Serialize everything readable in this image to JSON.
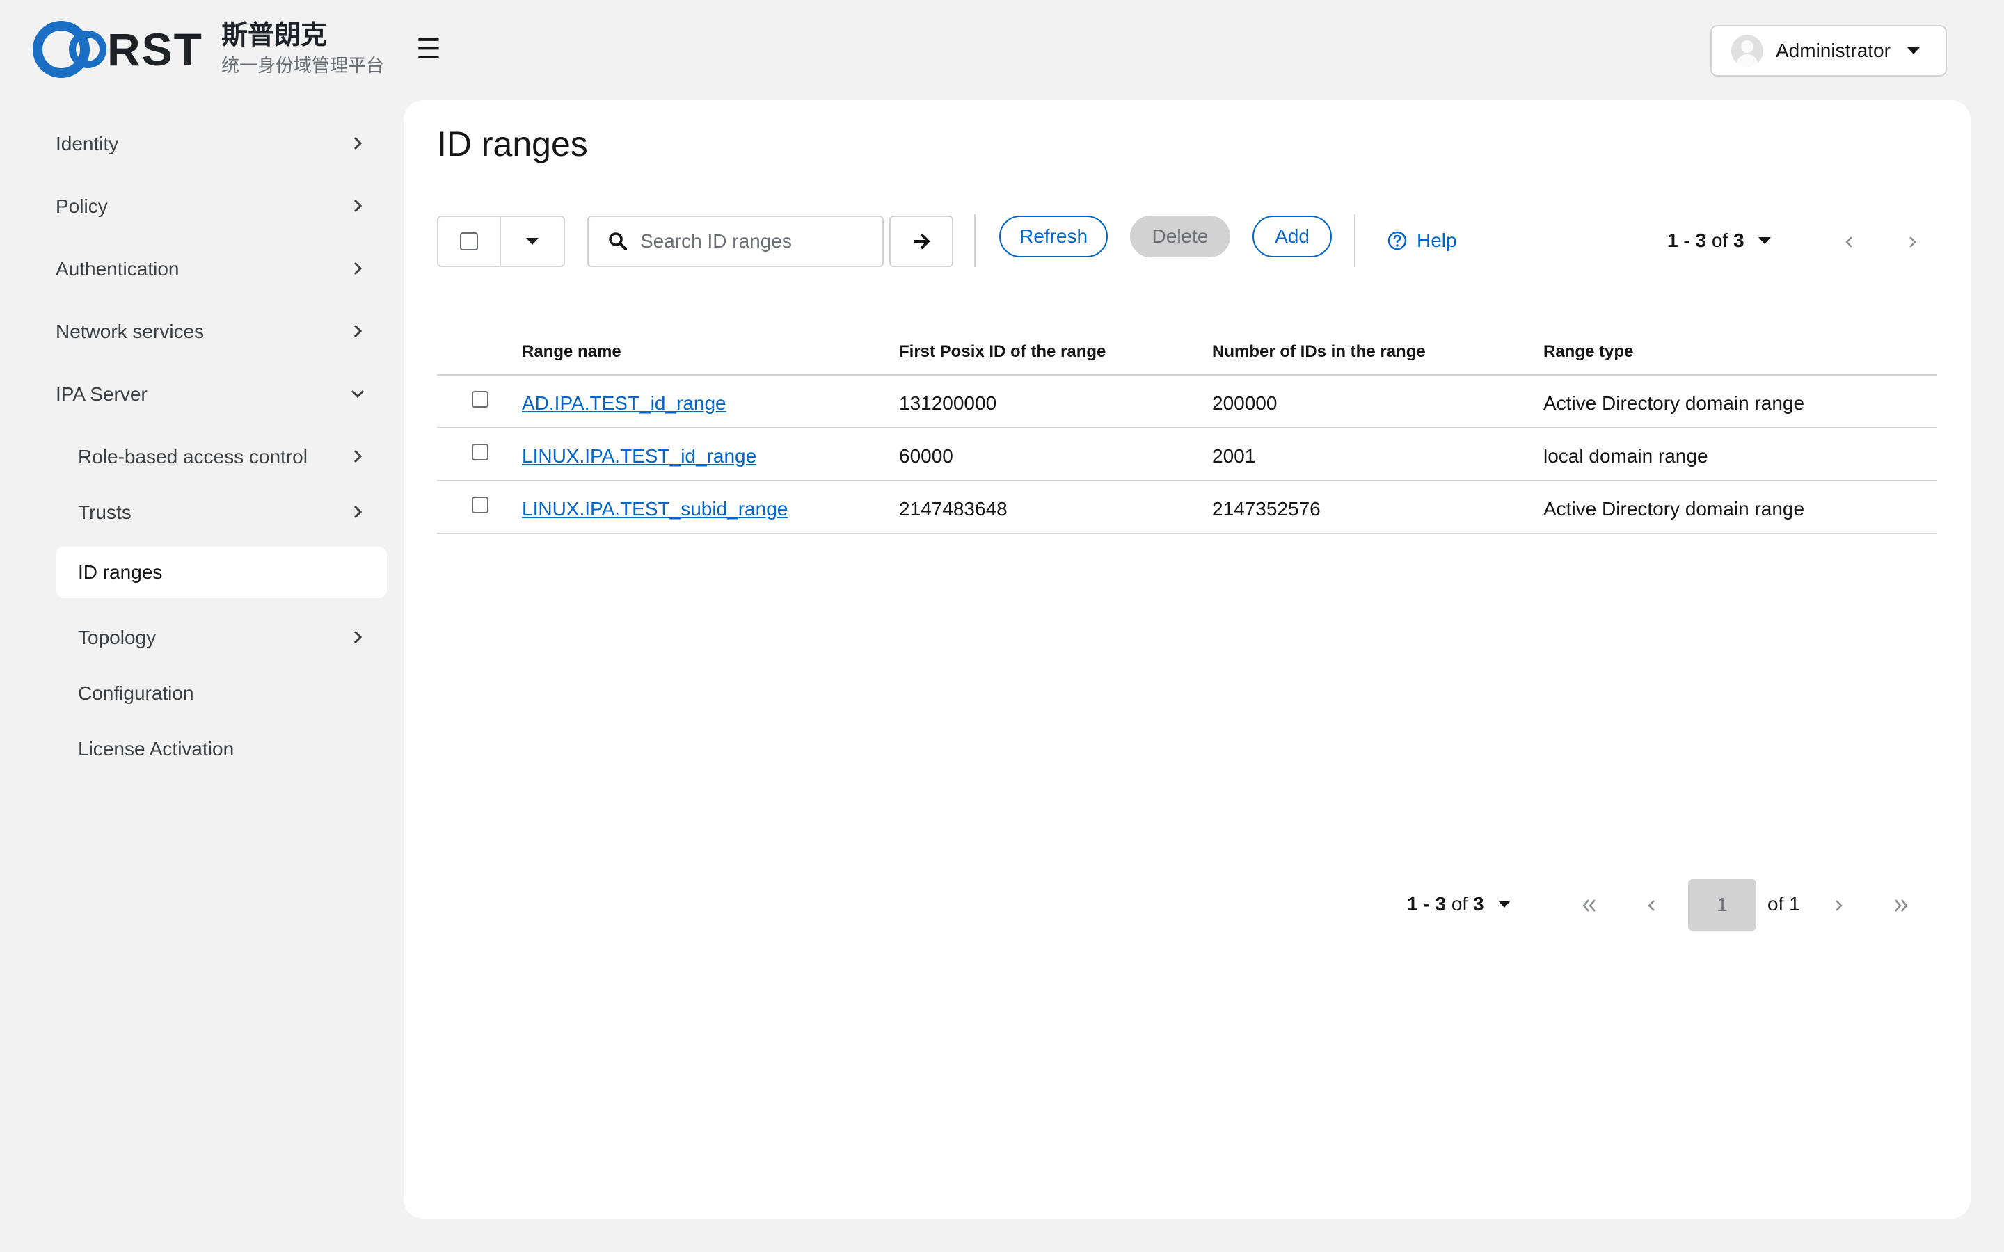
{
  "brand": {
    "logo_text": "RST",
    "name_cn": "斯普朗克",
    "subtitle_cn": "统一身份域管理平台"
  },
  "header": {
    "menu_icon": "☰",
    "user_name": "Administrator"
  },
  "sidebar": {
    "items": [
      {
        "label": "Identity",
        "icon": "chevron-right"
      },
      {
        "label": "Policy",
        "icon": "chevron-right"
      },
      {
        "label": "Authentication",
        "icon": "chevron-right"
      },
      {
        "label": "Network services",
        "icon": "chevron-right"
      },
      {
        "label": "IPA Server",
        "icon": "chevron-down",
        "expanded": true
      },
      {
        "label": "Role-based access control",
        "icon": "chevron-right"
      },
      {
        "label": "Trusts",
        "icon": "chevron-right"
      },
      {
        "label": "ID ranges",
        "active": true
      },
      {
        "label": "Topology",
        "icon": "chevron-right"
      },
      {
        "label": "Configuration"
      },
      {
        "label": "License Activation"
      }
    ]
  },
  "main": {
    "title": "ID ranges",
    "search": {
      "placeholder": "Search ID ranges",
      "value": ""
    },
    "toolbar": {
      "refresh_label": "Refresh",
      "delete_label": "Delete",
      "add_label": "Add",
      "help_label": "Help"
    },
    "pagination": {
      "range_start": "1",
      "range_end": "3",
      "of_label": "of",
      "total": "3",
      "current_page": "1",
      "pages_label": "of 1"
    },
    "table": {
      "columns": [
        "Range name",
        "First Posix ID of the range",
        "Number of IDs in the range",
        "Range type"
      ],
      "rows": [
        [
          "AD.IPA.TEST_id_range",
          "131200000",
          "200000",
          "Active Directory domain range"
        ],
        [
          "LINUX.IPA.TEST_id_range",
          "60000",
          "2001",
          "local domain range"
        ],
        [
          "LINUX.IPA.TEST_subid_range",
          "2147483648",
          "2147352576",
          "Active Directory domain range"
        ]
      ]
    }
  },
  "colors": {
    "accent": "#0066cc",
    "logo_blue": "#1a6fc4",
    "background": "#f2f2f2",
    "card": "#ffffff",
    "border": "#d2d2d2"
  }
}
